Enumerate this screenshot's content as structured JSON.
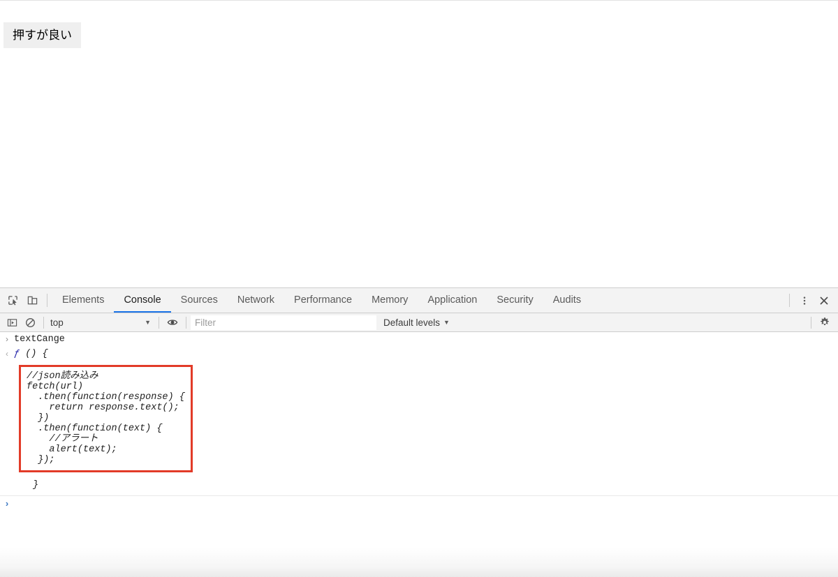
{
  "page": {
    "button_label": "押すが良い"
  },
  "devtools": {
    "tabstrip": {
      "inspect_icon": "inspect-cursor-icon",
      "device_icon": "device-toolbar-icon",
      "tabs": [
        {
          "label": "Elements",
          "active": false
        },
        {
          "label": "Console",
          "active": true
        },
        {
          "label": "Sources",
          "active": false
        },
        {
          "label": "Network",
          "active": false
        },
        {
          "label": "Performance",
          "active": false
        },
        {
          "label": "Memory",
          "active": false
        },
        {
          "label": "Application",
          "active": false
        },
        {
          "label": "Security",
          "active": false
        },
        {
          "label": "Audits",
          "active": false
        }
      ],
      "more_icon": "vertical-dots-icon",
      "close_icon": "close-icon"
    },
    "optionsbar": {
      "sidebar_icon": "console-sidebar-icon",
      "clear_icon": "clear-console-icon",
      "context_value": "top",
      "context_caret": "▼",
      "eye_icon": "live-expression-eye-icon",
      "filter_placeholder": "Filter",
      "filter_value": "",
      "levels_label": "Default levels",
      "levels_caret": "▼",
      "settings_icon": "gear-icon"
    },
    "console": {
      "input_arrow": "›",
      "input_expression": "textCange",
      "output_arrow": "‹",
      "output_fn_italic": "ƒ",
      "output_fn_signature": " () {",
      "highlighted_code": "//json読み込み\nfetch(url)\n  .then(function(response) {\n    return response.text();\n  })\n  .then(function(text) {\n    //アラート\n    alert(text);\n  });",
      "fn_closing_brace": "}",
      "prompt_arrow": "›",
      "prompt_value": ""
    }
  },
  "colors": {
    "accent_tab_underline": "#1a73e8",
    "highlight_border": "#e23b28",
    "toolbar_bg": "#f3f3f3",
    "page_button_bg": "#efefef",
    "fn_keyword": "#1a1aa6",
    "prompt_arrow": "#3b78c4"
  }
}
